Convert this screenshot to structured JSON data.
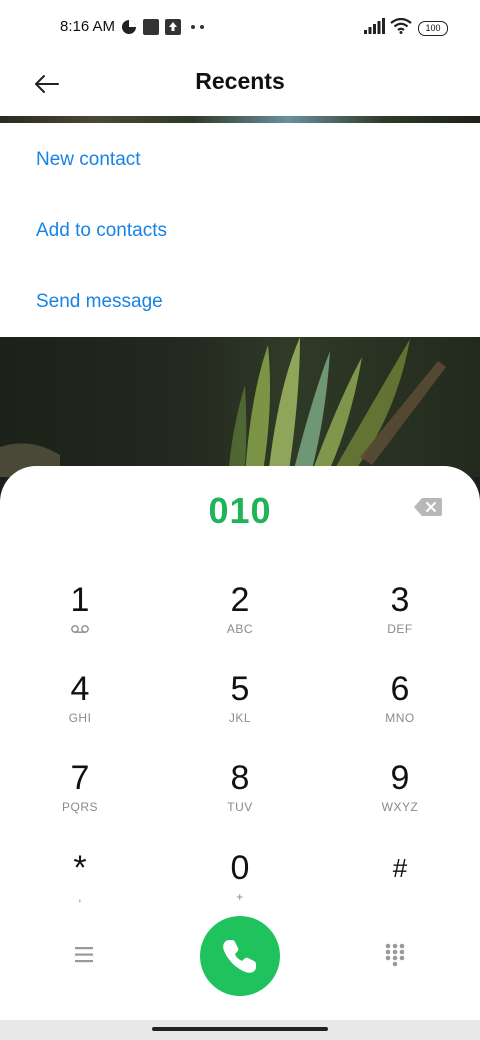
{
  "status_bar": {
    "time": "8:16 AM",
    "battery": "100",
    "icons": [
      "data-saver-icon",
      "stop-icon",
      "upload-icon",
      "more-dots-icon",
      "signal-icon",
      "wifi-icon",
      "battery-icon"
    ]
  },
  "header": {
    "title": "Recents",
    "back_icon": "back-arrow-icon"
  },
  "menu": {
    "items": [
      "New contact",
      "Add to contacts",
      "Send message"
    ]
  },
  "dialer": {
    "number": "010",
    "keys": [
      {
        "digit": "1",
        "letters": "voicemail-icon"
      },
      {
        "digit": "2",
        "letters": "ABC"
      },
      {
        "digit": "3",
        "letters": "DEF"
      },
      {
        "digit": "4",
        "letters": "GHI"
      },
      {
        "digit": "5",
        "letters": "JKL"
      },
      {
        "digit": "6",
        "letters": "MNO"
      },
      {
        "digit": "7",
        "letters": "PQRS"
      },
      {
        "digit": "8",
        "letters": "TUV"
      },
      {
        "digit": "9",
        "letters": "WXYZ"
      },
      {
        "digit": "*",
        "letters": ","
      },
      {
        "digit": "0",
        "letters": "+"
      },
      {
        "digit": "#",
        "letters": ""
      }
    ]
  },
  "colors": {
    "accent_link": "#1783e6",
    "number_green": "#21b35a",
    "call_green": "#1fc25d"
  }
}
